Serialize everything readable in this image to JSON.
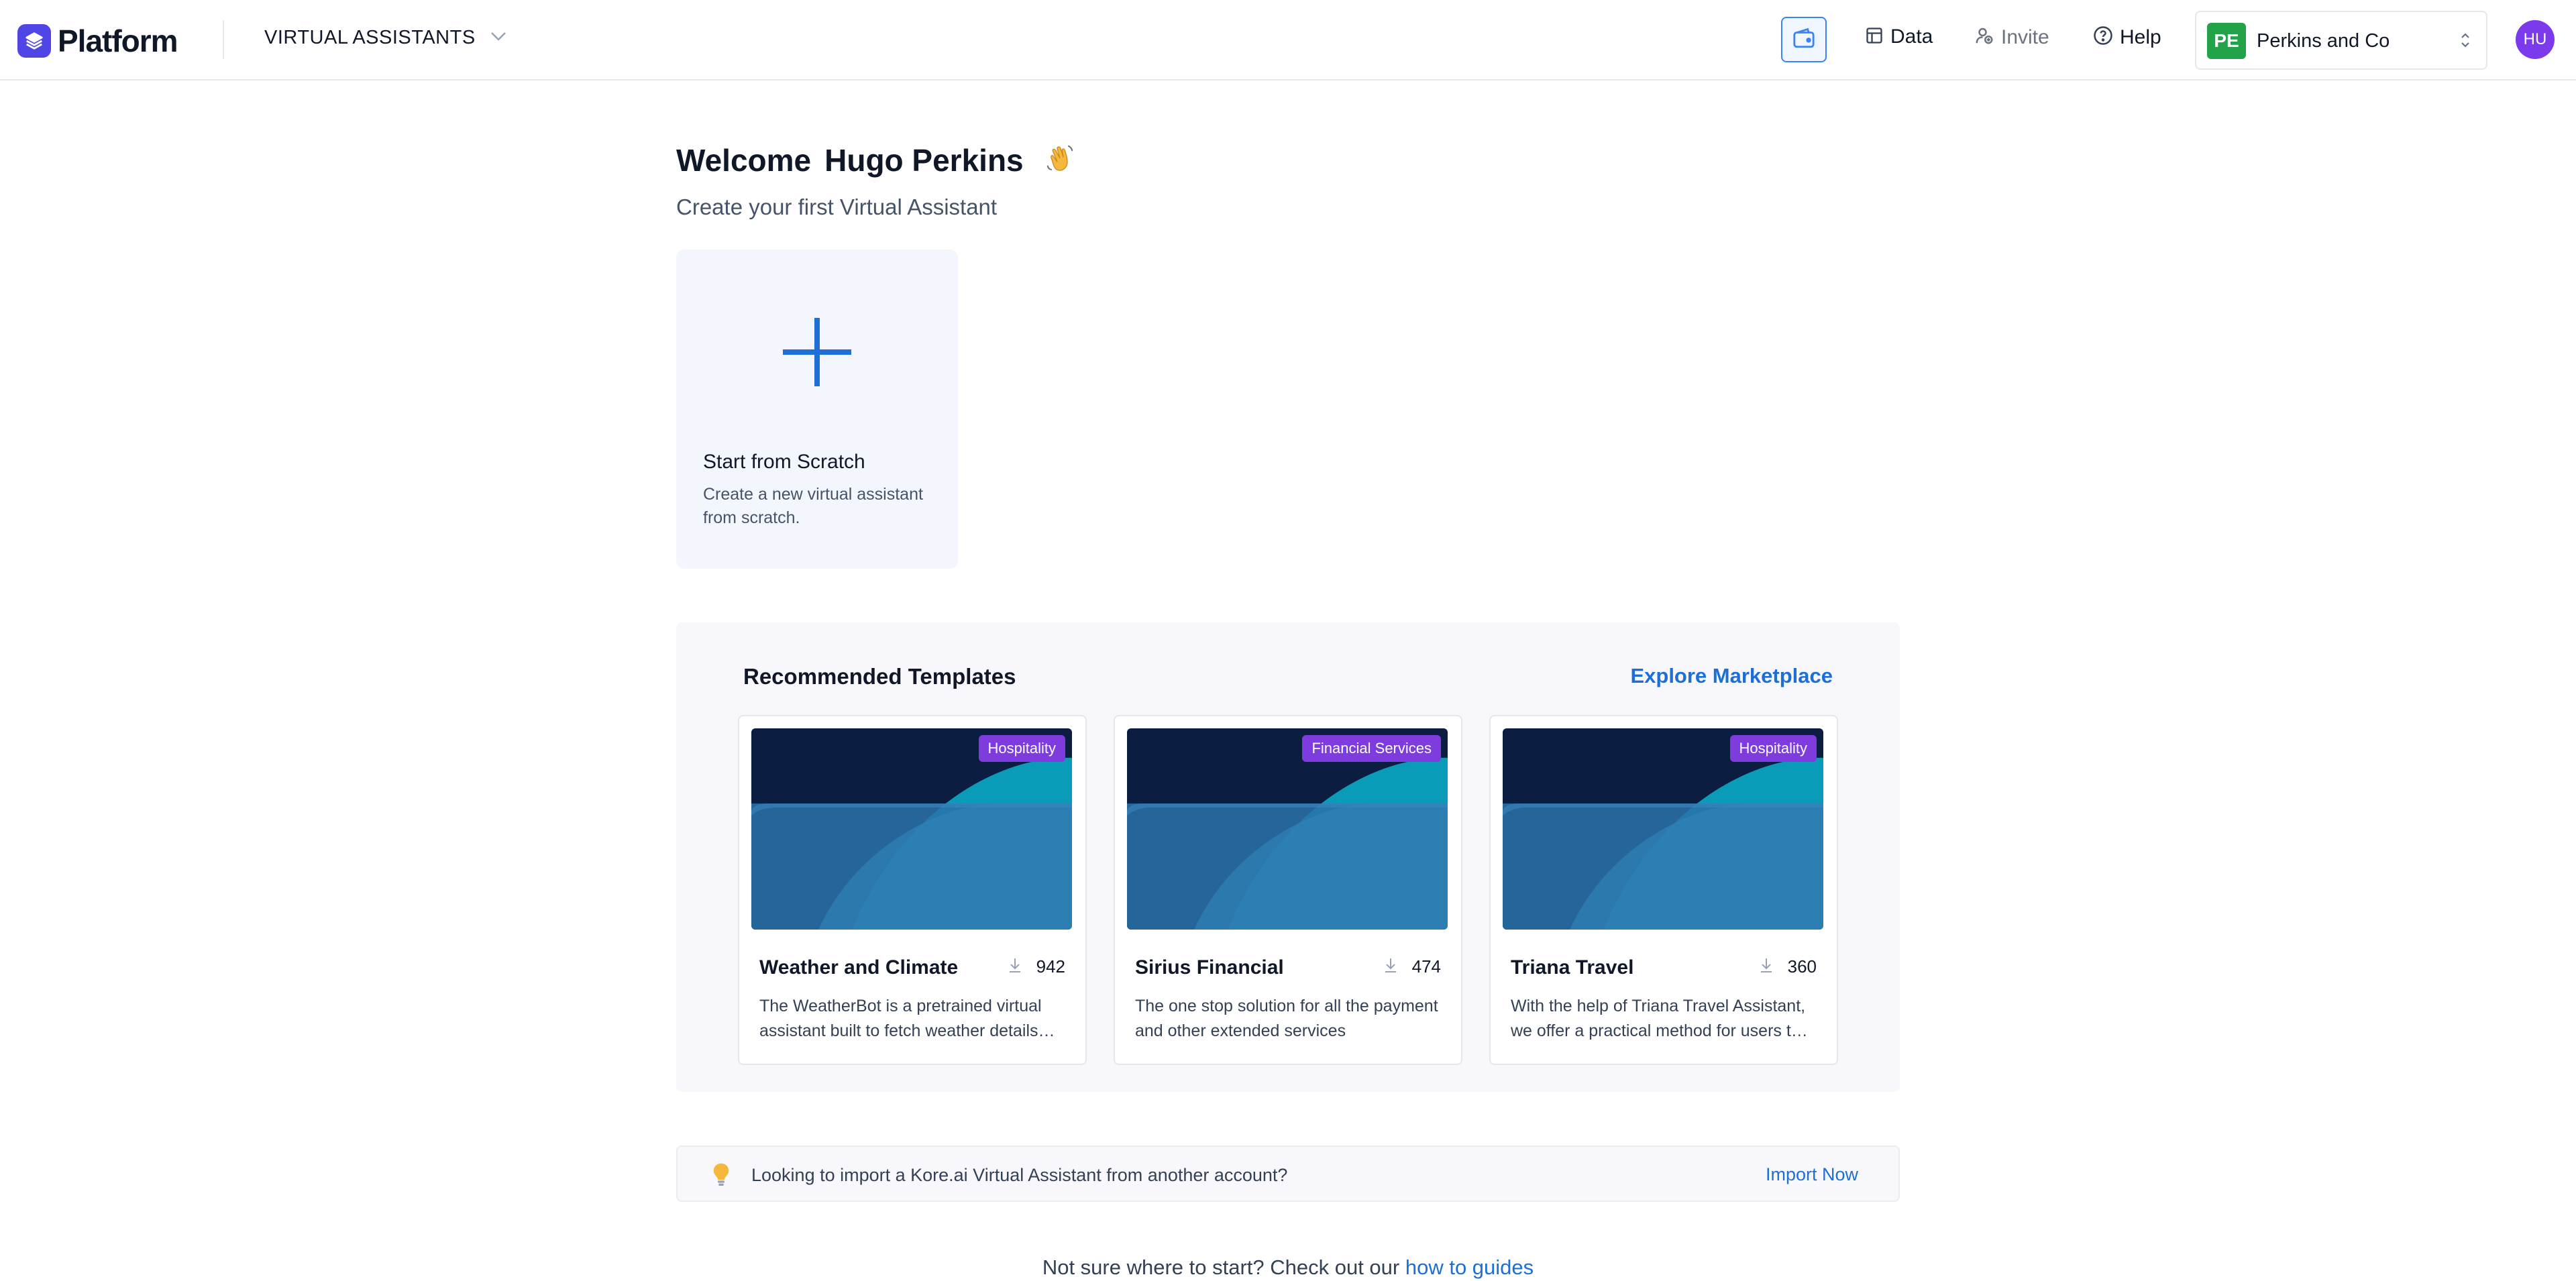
{
  "header": {
    "logo_text": "Platform",
    "app_switcher_label": "VIRTUAL ASSISTANTS",
    "nav": {
      "data": "Data",
      "invite": "Invite",
      "help": "Help"
    },
    "account": {
      "initials": "PE",
      "name": "Perkins and Co"
    },
    "avatar_initials": "HU"
  },
  "welcome": {
    "greeting": "Welcome",
    "name": "Hugo Perkins",
    "subtitle": "Create your first Virtual Assistant"
  },
  "scratch_card": {
    "title": "Start from Scratch",
    "description": "Create a new virtual assistant from scratch."
  },
  "templates": {
    "heading": "Recommended Templates",
    "explore_label": "Explore Marketplace",
    "cards": [
      {
        "badge": "Hospitality",
        "title": "Weather and Climate",
        "downloads": "942",
        "description": "The WeatherBot is a pretrained virtual assistant built to fetch weather details and forecasts for any location."
      },
      {
        "badge": "Financial Services",
        "title": "Sirius Financial",
        "downloads": "474",
        "description": "The one stop solution for all the payment and other extended services"
      },
      {
        "badge": "Hospitality",
        "title": "Triana Travel",
        "downloads": "360",
        "description": "With the help of Triana Travel Assistant, we offer a practical method for users to plan and book trips."
      }
    ]
  },
  "import": {
    "text": "Looking to import a Kore.ai Virtual Assistant from another account?",
    "link": "Import Now"
  },
  "footer": {
    "text": "Not sure where to start? Check out our ",
    "link": "how to guides"
  },
  "colors": {
    "brand": "#4f46e5",
    "link": "#1d6fd6",
    "badge": "#7e3cdf",
    "account_badge": "#22a34a",
    "avatar": "#7c3aed",
    "plus": "#1d6fd6"
  },
  "icons": {
    "logo": "layers-icon",
    "switcher": "chevron-down-icon",
    "wallet": "wallet-icon",
    "data": "table-icon",
    "invite": "user-plus-icon",
    "help": "help-circle-icon",
    "account_switch": "chevron-up-down-icon",
    "wave": "waving-hand-icon",
    "plus": "plus-icon",
    "download": "download-icon",
    "bulb": "lightbulb-icon"
  }
}
